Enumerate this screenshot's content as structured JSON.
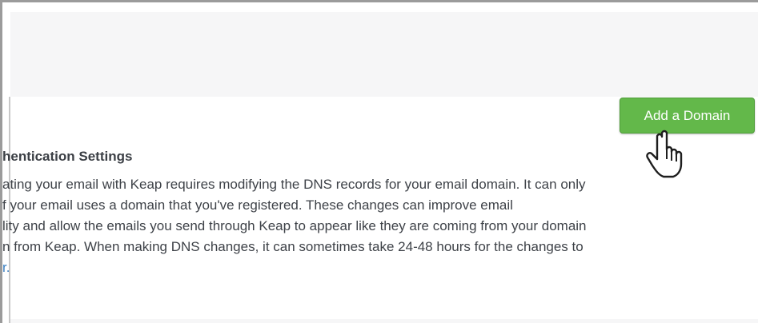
{
  "button": {
    "label": "Add a Domain"
  },
  "section": {
    "title": "hentication Settings",
    "lines": [
      "ating your email with Keap requires modifying the DNS records for your email domain. It can only",
      "f your email uses a domain that you've registered. These changes can improve email",
      "lity and allow the emails you send through Keap to appear like they are coming from your domain",
      "n from Keap. When making DNS changes, it can sometimes take 24-48 hours for the changes to"
    ],
    "last_fragment": "r."
  },
  "colors": {
    "button_green": "#63b84a",
    "text": "#3e4248",
    "link": "#3a7fc1",
    "band": "#f6f6f7"
  },
  "icons": {
    "cursor": "hand-pointer-icon"
  }
}
